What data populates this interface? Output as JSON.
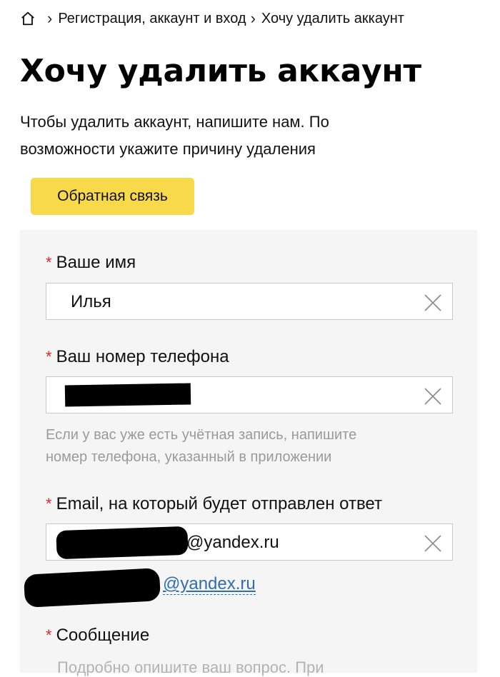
{
  "breadcrumb": {
    "home_icon": "home-icon",
    "items": [
      "Регистрация, аккаунт и вход",
      "Хочу удалить аккаунт"
    ]
  },
  "page": {
    "title": "Хочу удалить аккаунт",
    "intro_line1": "Чтобы удалить аккаунт, напишите нам. По",
    "intro_line2": "возможности укажите причину удаления"
  },
  "feedback_button": {
    "label": "Обратная связь",
    "color": "#f8d94a"
  },
  "form": {
    "required_mark": "*",
    "name": {
      "label": "Ваше имя",
      "value": "Илья"
    },
    "phone": {
      "label": "Ваш номер телефона",
      "value": "",
      "hint_line1": "Если у вас уже есть учётная запись, напишите",
      "hint_line2": "номер телефона, указанный в приложении"
    },
    "email": {
      "label": "Email, на который будет отправлен ответ",
      "value_visible": "@yandex.ru",
      "suggestion_visible": "@yandex.ru"
    },
    "message": {
      "label": "Сообщение",
      "placeholder": "Подробно опишите ваш вопрос. При"
    }
  },
  "colors": {
    "required": "#e0272b",
    "link": "#2b6fb0",
    "form_bg": "#f5f5f5"
  }
}
